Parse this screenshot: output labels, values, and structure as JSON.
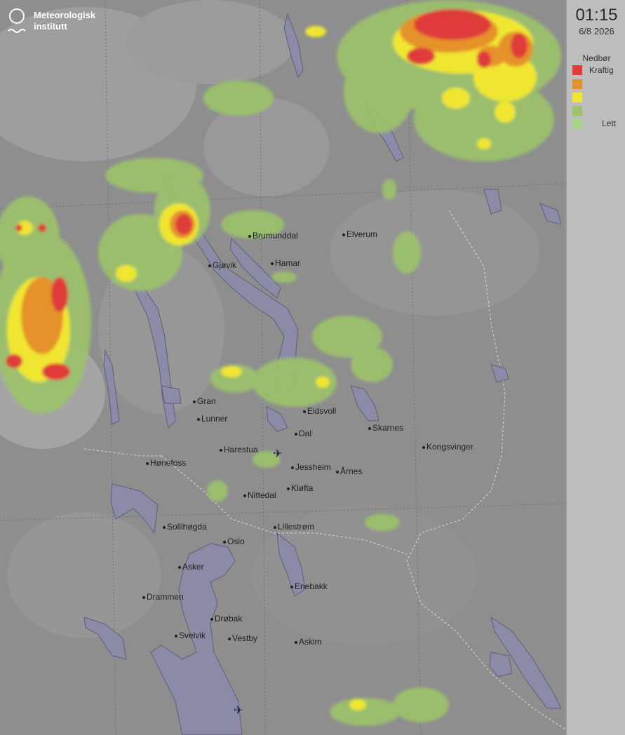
{
  "header": {
    "org_line1": "Meteorologisk",
    "org_line2": "institutt",
    "time": "01:15",
    "date": "6/8 2026"
  },
  "legend": {
    "title": "Nedbør",
    "items": [
      {
        "label": "Kraftig",
        "color": "#e03a3a"
      },
      {
        "label": "",
        "color": "#e5922a"
      },
      {
        "label": "",
        "color": "#f0e630"
      },
      {
        "label": "",
        "color": "#9cc46a"
      },
      {
        "label": "Lett",
        "color": "#a8d48a"
      }
    ]
  },
  "colors": {
    "water": "#8b8ba8",
    "terrain": "#8e8e8e",
    "precip_heavy": "#e03a3a",
    "precip_strong": "#e5922a",
    "precip_moderate": "#f0e630",
    "precip_light": "#9cc46a"
  },
  "places": [
    {
      "name": "Brumunddal"
    },
    {
      "name": "Elverum"
    },
    {
      "name": "Gjøvik"
    },
    {
      "name": "Hamar"
    },
    {
      "name": "Eidsvoll"
    },
    {
      "name": "Gran"
    },
    {
      "name": "Lunner"
    },
    {
      "name": "Dal"
    },
    {
      "name": "Skarnes"
    },
    {
      "name": "Kongsvinger"
    },
    {
      "name": "Harestua"
    },
    {
      "name": "Hønefoss"
    },
    {
      "name": "Jessheim"
    },
    {
      "name": "Årnes"
    },
    {
      "name": "Kløfta"
    },
    {
      "name": "Nittedal"
    },
    {
      "name": "Sollihøgda"
    },
    {
      "name": "Lillestrøm"
    },
    {
      "name": "Oslo"
    },
    {
      "name": "Asker"
    },
    {
      "name": "Enebakk"
    },
    {
      "name": "Drammen"
    },
    {
      "name": "Drøbak"
    },
    {
      "name": "Svelvik"
    },
    {
      "name": "Vestby"
    },
    {
      "name": "Askim"
    }
  ],
  "airports": [
    {
      "icon": "airplane-icon"
    },
    {
      "icon": "airplane-icon"
    }
  ]
}
